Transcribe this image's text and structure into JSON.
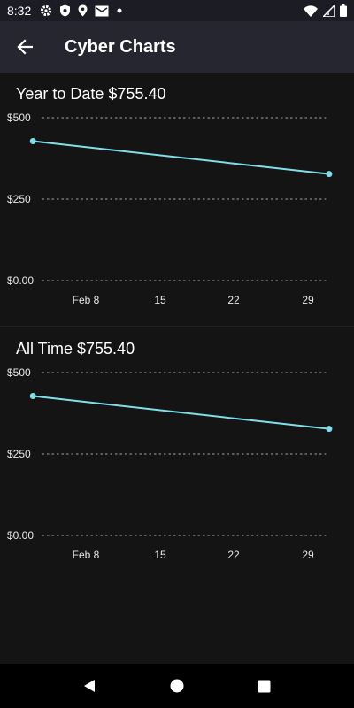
{
  "status_bar": {
    "time": "8:32",
    "left_icons": [
      "gear-icon",
      "shield-icon",
      "location-pin-icon",
      "mail-icon",
      "dot-icon"
    ],
    "right_icons": [
      "wifi-icon",
      "signal-icon",
      "battery-icon"
    ]
  },
  "app_bar": {
    "back_icon": "arrow-left-icon",
    "title": "Cyber Charts"
  },
  "chart_data": [
    {
      "type": "line",
      "title_label": "Year to Date",
      "title_value": "$755.40",
      "x_tick_labels": [
        "Feb 8",
        "15",
        "22",
        "29"
      ],
      "y_tick_labels": [
        "$500",
        "$250",
        "$0.00"
      ],
      "ylim": [
        0,
        500
      ],
      "grid": true,
      "series": [
        {
          "color": "#80deea",
          "points": [
            {
              "x": "Feb 3",
              "y": 428
            },
            {
              "x": "Mar 2",
              "y": 327
            }
          ]
        }
      ]
    },
    {
      "type": "line",
      "title_label": "All Time",
      "title_value": "$755.40",
      "x_tick_labels": [
        "Feb 8",
        "15",
        "22",
        "29"
      ],
      "y_tick_labels": [
        "$500",
        "$250",
        "$0.00"
      ],
      "ylim": [
        0,
        500
      ],
      "grid": true,
      "series": [
        {
          "color": "#80deea",
          "points": [
            {
              "x": "Feb 3",
              "y": 428
            },
            {
              "x": "Mar 2",
              "y": 327
            }
          ]
        }
      ]
    }
  ],
  "nav_bar": {
    "buttons": [
      "back-triangle-icon",
      "home-circle-icon",
      "recents-square-icon"
    ]
  }
}
